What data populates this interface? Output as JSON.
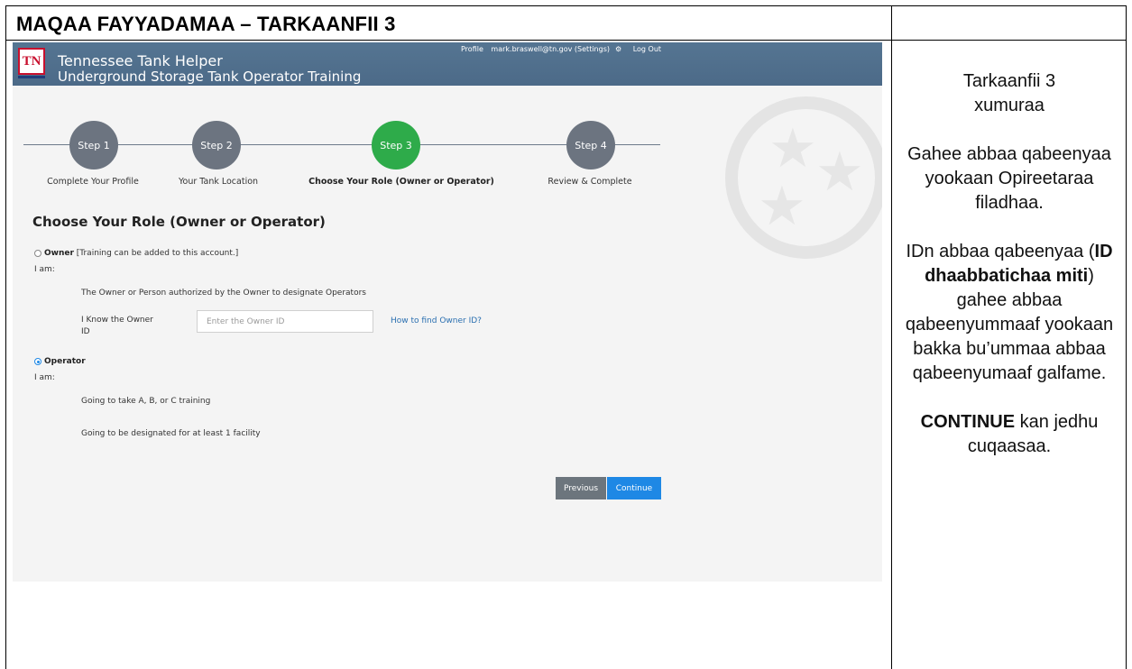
{
  "doc": {
    "title": "MAQAA FAYYADAMAA – TARKAANFII 3",
    "side": {
      "line1": "Tarkaanfii 3",
      "line2": "xumuraa",
      "para1": "Gahee abbaa qabeenyaa yookaan Opireetaraa filadhaa.",
      "para2_pre": "IDn abbaa qabeenyaa (",
      "para2_bold": "ID dhaabbatichaa miti",
      "para2_post": ") gahee abbaa qabeenyummaaf yookaan bakka bu’ummaa abbaa qabeenyumaaf galfame.",
      "para3_bold": "CONTINUE",
      "para3_post": " kan jedhu cuqaasaa."
    }
  },
  "app": {
    "logo": "TN",
    "title": "Tennessee Tank Helper",
    "subtitle": "Underground Storage Tank Operator Training",
    "nav": {
      "profile": "Profile",
      "user": "mark.braswell@tn.gov (Settings)",
      "gear_icon": "gear-icon",
      "logout": "Log Out"
    }
  },
  "stepper": {
    "steps": [
      {
        "label": "Step 1",
        "caption": "Complete Your Profile",
        "state": "done"
      },
      {
        "label": "Step 2",
        "caption": "Your Tank Location",
        "state": "done"
      },
      {
        "label": "Step 3",
        "caption": "Choose Your Role (Owner or Operator)",
        "state": "active"
      },
      {
        "label": "Step 4",
        "caption": "Review & Complete",
        "state": "pending"
      }
    ],
    "active_color": "#2eab4a",
    "inactive_color": "#6c7480"
  },
  "form": {
    "heading": "Choose Your Role (Owner or Operator)",
    "owner": {
      "radio_label": "Owner",
      "note": "[Training can be added to this account.]",
      "i_am": "I am:",
      "desc": "The Owner or Person authorized by the Owner to designate Operators",
      "field_label_1": "I Know the Owner",
      "field_label_2": "ID",
      "placeholder": "Enter the Owner ID",
      "help_link": "How to find Owner ID?",
      "selected": false
    },
    "operator": {
      "radio_label": "Operator",
      "i_am": "I am:",
      "desc1": "Going to take A, B, or C training",
      "desc2": "Going to be designated for at least 1 facility",
      "selected": true
    },
    "buttons": {
      "previous": "Previous",
      "continue": "Continue"
    }
  }
}
